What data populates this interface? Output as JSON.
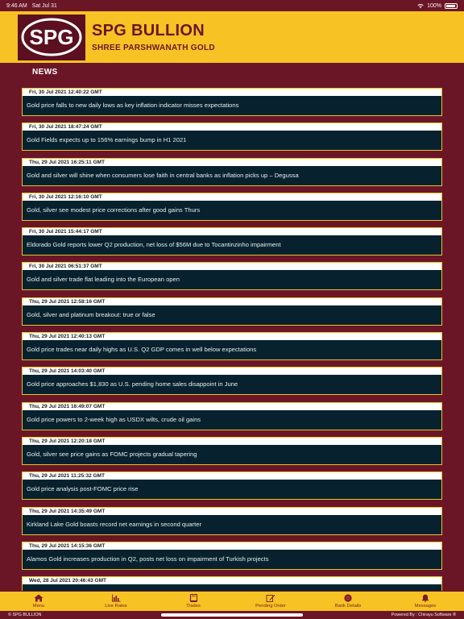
{
  "status_bar": {
    "time": "9:46 AM",
    "date": "Sat Jul 31",
    "battery": "100%"
  },
  "header": {
    "logo_text": "SPG",
    "title": "SPG BULLION",
    "subtitle": "SHREE PARSHWANATH GOLD",
    "colors": {
      "header_bg": "#f6c224",
      "brand": "#6b1627",
      "logo_bg": "#5b0f1f"
    }
  },
  "section": {
    "title": "NEWS"
  },
  "news": [
    {
      "date": "Fri, 30 Jul 2021 12:40:22 GMT",
      "headline": "Gold price falls to new daily lows as key inflation indicator misses expectations"
    },
    {
      "date": "Fri, 30 Jul 2021 18:47:24 GMT",
      "headline": "Gold Fields expects up to 156% earnings bump in H1 2021"
    },
    {
      "date": "Thu, 29 Jul 2021 16:25:11 GMT",
      "headline": "Gold and silver will shine when consumers lose faith in central banks as inflation picks up – Degussa"
    },
    {
      "date": "Fri, 30 Jul 2021 12:16:10 GMT",
      "headline": "Gold, silver see modest price corrections after good gains Thurs"
    },
    {
      "date": "Fri, 30 Jul 2021 15:44:17 GMT",
      "headline": "Eldorado Gold reports lower Q2 production, net loss of $56M due to Tocantinzinho impairment"
    },
    {
      "date": "Fri, 30 Jul 2021 06:51:37 GMT",
      "headline": "Gold and silver trade flat leading into the European open"
    },
    {
      "date": "Thu, 29 Jul 2021 12:58:16 GMT",
      "headline": "Gold, silver and platinum breakout: true or false"
    },
    {
      "date": "Thu, 29 Jul 2021 12:40:13 GMT",
      "headline": "Gold price trades near daily highs as U.S. Q2 GDP comes in well below expectations"
    },
    {
      "date": "Thu, 29 Jul 2021 14:03:40 GMT",
      "headline": "Gold price approaches $1,830 as U.S. pending home sales disappoint in June"
    },
    {
      "date": "Thu, 29 Jul 2021 16:49:07 GMT",
      "headline": "Gold price powers to 2-week high as USDX wilts, crude oil gains"
    },
    {
      "date": "Thu, 29 Jul 2021 12:20:18 GMT",
      "headline": "Gold, silver see price gains as FOMC projects gradual tapering"
    },
    {
      "date": "Thu, 29 Jul 2021 11:25:32 GMT",
      "headline": "Gold price analysis post-FOMC price rise"
    },
    {
      "date": "Thu, 29 Jul 2021 14:35:49 GMT",
      "headline": "Kirkland Lake Gold boasts record net earnings in second quarter"
    },
    {
      "date": "Thu, 29 Jul 2021 14:15:36 GMT",
      "headline": "Alamos Gold increases production in Q2, posts net loss on impairment of Turkish projects"
    },
    {
      "date": "Wed, 28 Jul 2021 20:46:43 GMT",
      "headline": ""
    }
  ],
  "tabs": [
    {
      "label": "Menu",
      "icon": "home-icon"
    },
    {
      "label": "Live Rates",
      "icon": "bar-chart-icon"
    },
    {
      "label": "Trades",
      "icon": "book-icon"
    },
    {
      "label": "Pending Order",
      "icon": "edit-icon"
    },
    {
      "label": "Bank Details",
      "icon": "bank-icon"
    },
    {
      "label": "Messages",
      "icon": "bell-icon"
    }
  ],
  "footer": {
    "left": "© SPG BULLION",
    "right": "Powered By : Chirayu Software ®"
  }
}
